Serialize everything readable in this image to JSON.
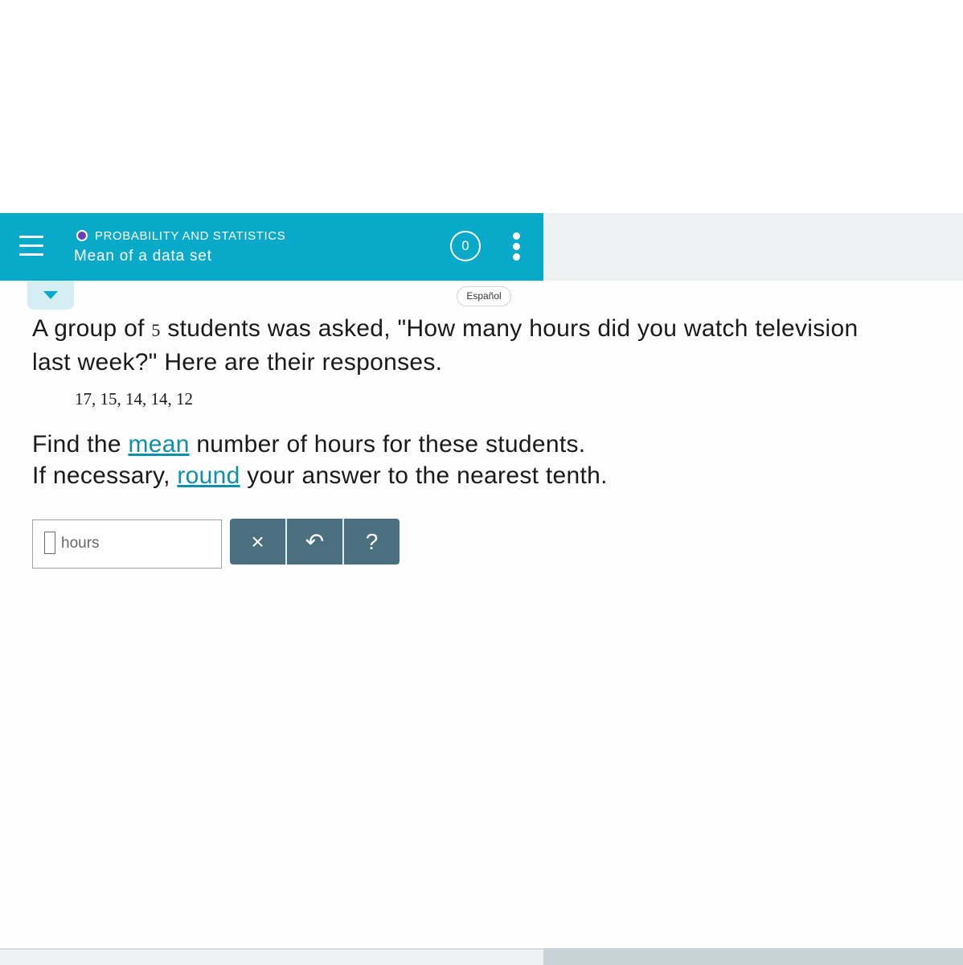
{
  "header": {
    "topic": "PROBABILITY AND STATISTICS",
    "lesson_title": "Mean of a data set",
    "score": "0",
    "menu_icon": "hamburger-icon",
    "more_icon": "kebab-icon",
    "topic_dot_color": "#6c3bb0",
    "accent_color": "#09a9c9"
  },
  "language_button": "Español",
  "question": {
    "part1": "A group of ",
    "count": "5",
    "part2": " students was asked, \"How many hours did you watch television",
    "line2": "last week?\" Here are their responses.",
    "data_values": "17, 15, 14, 14, 12"
  },
  "instruction": {
    "line1_before": "Find the ",
    "line1_link": "mean",
    "line1_after": " number of hours for these students.",
    "line2_before": "If necessary, ",
    "line2_link": "round",
    "line2_after": " your answer to the nearest tenth."
  },
  "answer": {
    "value": "",
    "unit": "hours"
  },
  "toolbar": {
    "clear": "×",
    "undo": "↶",
    "help": "?"
  }
}
